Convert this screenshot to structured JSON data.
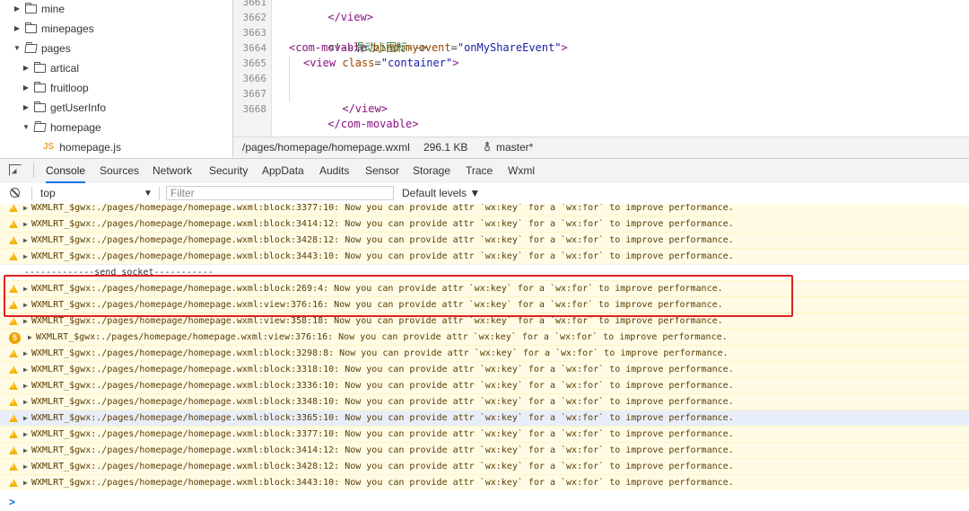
{
  "file_tree": [
    {
      "label": "mine",
      "type": "folder",
      "expanded": false,
      "depth": 0
    },
    {
      "label": "minepages",
      "type": "folder",
      "expanded": false,
      "depth": 0
    },
    {
      "label": "pages",
      "type": "folder",
      "expanded": true,
      "depth": 0
    },
    {
      "label": "artical",
      "type": "folder",
      "expanded": false,
      "depth": 1
    },
    {
      "label": "fruitloop",
      "type": "folder",
      "expanded": false,
      "depth": 1
    },
    {
      "label": "getUserInfo",
      "type": "folder",
      "expanded": false,
      "depth": 1
    },
    {
      "label": "homepage",
      "type": "folder",
      "expanded": true,
      "depth": 1
    },
    {
      "label": "homepage.js",
      "type": "file",
      "depth": 2
    }
  ],
  "editor": {
    "line_numbers": [
      "3661",
      "3662",
      "3663",
      "3664",
      "3665",
      "3666",
      "3667",
      "3668"
    ],
    "code": {
      "l3661_tag": "</view>",
      "l3663_comment": "<!--滑动小图标-->",
      "l3664_open": "<com-movable ",
      "l3664_attr": "bind:myevent",
      "l3664_eq": "=",
      "l3664_val": "\"onMyShareEvent\"",
      "l3664_close": ">",
      "l3665_open": "<view ",
      "l3665_attr": "class",
      "l3665_eq": "=",
      "l3665_val": "\"container\"",
      "l3665_close": ">",
      "l3667_tag": "</view>",
      "l3668_tag": "</com-movable>"
    },
    "status": {
      "path": "/pages/homepage/homepage.wxml",
      "size": "296.1 KB",
      "branch": "master*"
    }
  },
  "devtools_tabs": [
    "Console",
    "Sources",
    "Network",
    "Security",
    "AppData",
    "Audits",
    "Sensor",
    "Storage",
    "Trace",
    "Wxml"
  ],
  "active_tab": "Console",
  "console_toolbar": {
    "context": "top",
    "filter_placeholder": "Filter",
    "levels": "Default levels ▼"
  },
  "messages": [
    {
      "kind": "warn",
      "text": "WXMLRT_$gwx:./pages/homepage/homepage.wxml:block:3377:10: Now you can provide attr `wx:key` for a `wx:for` to improve performance."
    },
    {
      "kind": "warn",
      "text": "WXMLRT_$gwx:./pages/homepage/homepage.wxml:block:3414:12: Now you can provide attr `wx:key` for a `wx:for` to improve performance."
    },
    {
      "kind": "warn",
      "text": "WXMLRT_$gwx:./pages/homepage/homepage.wxml:block:3428:12: Now you can provide attr `wx:key` for a `wx:for` to improve performance."
    },
    {
      "kind": "warn",
      "text": "WXMLRT_$gwx:./pages/homepage/homepage.wxml:block:3443:10: Now you can provide attr `wx:key` for a `wx:for` to improve performance."
    },
    {
      "kind": "log",
      "text": "-------------send socket-----------"
    },
    {
      "kind": "warn",
      "text": "WXMLRT_$gwx:./pages/homepage/homepage.wxml:block:269:4: Now you can provide attr `wx:key` for a `wx:for` to improve performance."
    },
    {
      "kind": "warn",
      "text": "WXMLRT_$gwx:./pages/homepage/homepage.wxml:view:376:16: Now you can provide attr `wx:key` for a `wx:for` to improve performance."
    },
    {
      "kind": "warn",
      "text": "WXMLRT_$gwx:./pages/homepage/homepage.wxml:view:358:18: Now you can provide attr `wx:key` for a `wx:for` to improve performance."
    },
    {
      "kind": "warn-count",
      "count": "5",
      "text": "WXMLRT_$gwx:./pages/homepage/homepage.wxml:view:376:16: Now you can provide attr `wx:key` for a `wx:for` to improve performance."
    },
    {
      "kind": "warn",
      "text": "WXMLRT_$gwx:./pages/homepage/homepage.wxml:block:3298:8: Now you can provide attr `wx:key` for a `wx:for` to improve performance."
    },
    {
      "kind": "warn",
      "text": "WXMLRT_$gwx:./pages/homepage/homepage.wxml:block:3318:10: Now you can provide attr `wx:key` for a `wx:for` to improve performance."
    },
    {
      "kind": "warn",
      "text": "WXMLRT_$gwx:./pages/homepage/homepage.wxml:block:3336:10: Now you can provide attr `wx:key` for a `wx:for` to improve performance."
    },
    {
      "kind": "warn",
      "text": "WXMLRT_$gwx:./pages/homepage/homepage.wxml:block:3348:10: Now you can provide attr `wx:key` for a `wx:for` to improve performance."
    },
    {
      "kind": "warn",
      "text": "WXMLRT_$gwx:./pages/homepage/homepage.wxml:block:3365:10: Now you can provide attr `wx:key` for a `wx:for` to improve performance."
    },
    {
      "kind": "warn",
      "text": "WXMLRT_$gwx:./pages/homepage/homepage.wxml:block:3377:10: Now you can provide attr `wx:key` for a `wx:for` to improve performance."
    },
    {
      "kind": "warn",
      "text": "WXMLRT_$gwx:./pages/homepage/homepage.wxml:block:3414:12: Now you can provide attr `wx:key` for a `wx:for` to improve performance."
    },
    {
      "kind": "warn",
      "text": "WXMLRT_$gwx:./pages/homepage/homepage.wxml:block:3428:12: Now you can provide attr `wx:key` for a `wx:for` to improve performance."
    },
    {
      "kind": "warn",
      "text": "WXMLRT_$gwx:./pages/homepage/homepage.wxml:block:3443:10: Now you can provide attr `wx:key` for a `wx:for` to improve performance."
    }
  ],
  "prompt_symbol": ">",
  "colors": {
    "warning": "#f4b400",
    "warning_bg": "#fffbe5",
    "highlight_box": "#e02020",
    "accent": "#1a73e8"
  }
}
